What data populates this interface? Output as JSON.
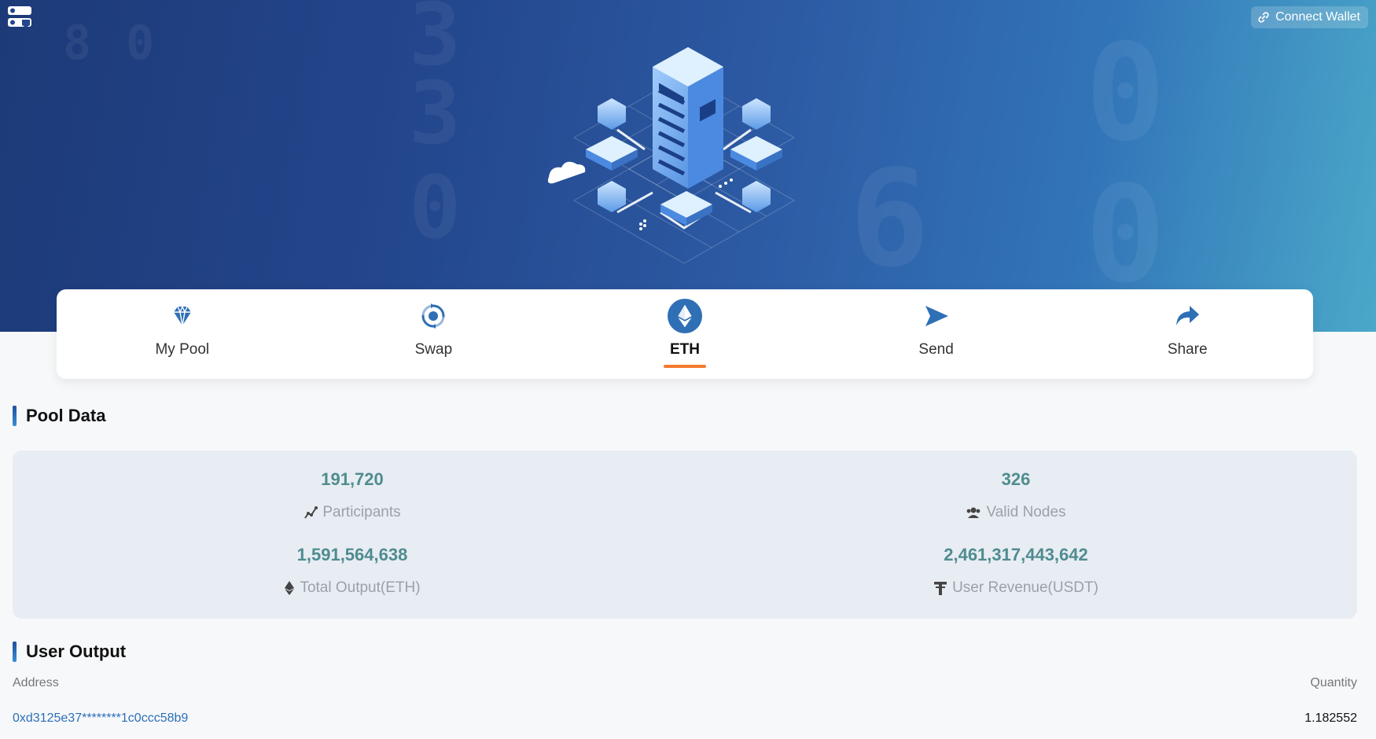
{
  "header": {
    "connect_wallet_label": "Connect Wallet"
  },
  "nav": {
    "items": [
      {
        "label": "My Pool",
        "icon": "diamond-icon"
      },
      {
        "label": "Swap",
        "icon": "swap-icon"
      },
      {
        "label": "ETH",
        "icon": "eth-icon",
        "active": true
      },
      {
        "label": "Send",
        "icon": "send-icon"
      },
      {
        "label": "Share",
        "icon": "share-icon"
      }
    ]
  },
  "pool": {
    "title": "Pool Data",
    "stats": [
      {
        "value": "191,720",
        "label": "Participants",
        "icon": "chart-line-icon"
      },
      {
        "value": "326",
        "label": "Valid Nodes",
        "icon": "users-icon"
      },
      {
        "value": "1,591,564,638",
        "label": "Total Output(ETH)",
        "icon": "eth-small-icon"
      },
      {
        "value": "2,461,317,443,642",
        "label": "User Revenue(USDT)",
        "icon": "tether-icon"
      }
    ]
  },
  "user_output": {
    "title": "User Output",
    "columns": {
      "address": "Address",
      "quantity": "Quantity"
    },
    "rows": [
      {
        "address": "0xd3125e37********1c0ccc58b9",
        "quantity": "1.182552"
      }
    ]
  },
  "colors": {
    "accent_blue": "#2f6fb5",
    "active_underline": "#f37a2e",
    "stat_value": "#4f8c8f"
  }
}
